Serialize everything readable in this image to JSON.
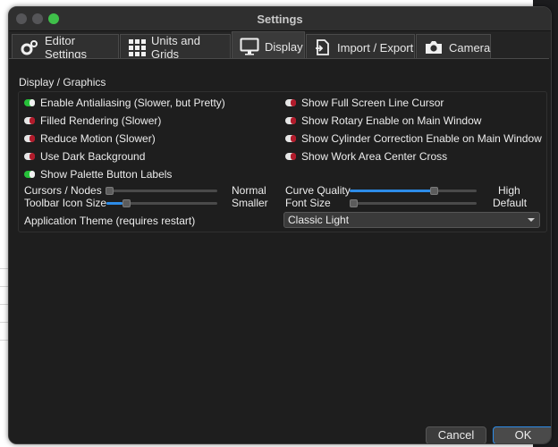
{
  "window": {
    "title": "Settings"
  },
  "tabs": [
    {
      "label": "Editor Settings",
      "icon": "gears-icon"
    },
    {
      "label": "Units and Grids",
      "icon": "grid-icon"
    },
    {
      "label": "Display",
      "icon": "monitor-icon",
      "active": true
    },
    {
      "label": "Import / Export",
      "icon": "import-export-icon"
    },
    {
      "label": "Camera",
      "icon": "camera-icon"
    }
  ],
  "display": {
    "group_title": "Display / Graphics",
    "left_options": [
      {
        "label": "Enable Antialiasing (Slower, but Pretty)",
        "checked": true
      },
      {
        "label": "Filled Rendering (Slower)",
        "checked": false
      },
      {
        "label": "Reduce Motion (Slower)",
        "checked": false
      },
      {
        "label": "Use Dark Background",
        "checked": false
      },
      {
        "label": "Show Palette Button Labels",
        "checked": true
      }
    ],
    "right_options": [
      {
        "label": "Show Full Screen Line Cursor",
        "checked": false
      },
      {
        "label": "Show Rotary Enable on Main Window",
        "checked": false
      },
      {
        "label": "Show Cylinder Correction Enable on Main Window",
        "checked": false
      },
      {
        "label": "Show Work Area Center Cross",
        "checked": false
      }
    ],
    "sliders": {
      "cursors_nodes": {
        "label": "Cursors / Nodes",
        "value_text": "Normal",
        "level": 0.0
      },
      "toolbar_icon_size": {
        "label": "Toolbar Icon Size",
        "value_text": "Smaller",
        "level": 0.12
      },
      "curve_quality": {
        "label": "Curve Quality",
        "value_text": "High",
        "level": 0.66
      },
      "font_size": {
        "label": "Font Size",
        "value_text": "Default",
        "level": 0.0
      }
    },
    "theme": {
      "label": "Application Theme (requires restart)",
      "value": "Classic Light"
    }
  },
  "buttons": {
    "cancel": "Cancel",
    "ok": "OK"
  },
  "colors": {
    "accent": "#2d8ce8",
    "toggle_on": "#27c13a",
    "toggle_off": "#b11b2b"
  }
}
